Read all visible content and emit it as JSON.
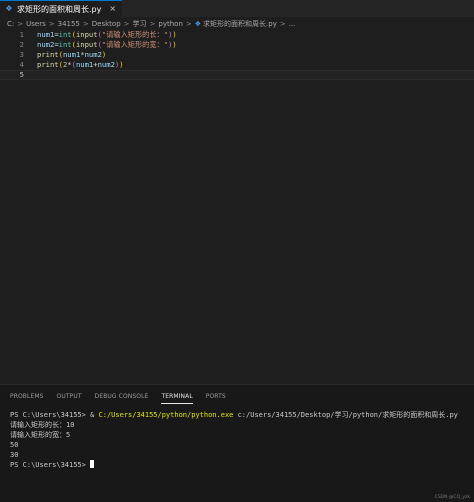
{
  "tab": {
    "title": "求矩形的面积和周长.py",
    "close": "×",
    "file_icon": "python-file-icon"
  },
  "breadcrumb": {
    "items": [
      "C:",
      "Users",
      "34155",
      "Desktop",
      "学习",
      "python"
    ],
    "separator": ">",
    "file": "求矩形的面积和周长.py",
    "trailing": "..."
  },
  "editor": {
    "line_numbers": [
      "1",
      "2",
      "3",
      "4",
      "5"
    ],
    "lines": [
      {
        "t1": "num1",
        "t2": "=",
        "t3": "int",
        "t4": "(",
        "t5": "input",
        "t6": "(",
        "t7": "\"请输入矩形的长：\"",
        "t8": ")",
        "t9": ")"
      },
      {
        "t1": "num2",
        "t2": "=",
        "t3": "int",
        "t4": "(",
        "t5": "input",
        "t6": "(",
        "t7": "\"请输入矩形的宽：\"",
        "t8": ")",
        "t9": ")"
      },
      {
        "t1": "print",
        "t2": "(",
        "t3": "num1",
        "t4": "*",
        "t5": "num2",
        "t6": ")"
      },
      {
        "t1": "print",
        "t2": "(",
        "t3": "2",
        "t4": "*",
        "t5": "(",
        "t6": "num1",
        "t7": "+",
        "t8": "num2",
        "t9": ")",
        "t10": ")"
      }
    ]
  },
  "panel": {
    "tabs": [
      "PROBLEMS",
      "OUTPUT",
      "DEBUG CONSOLE",
      "TERMINAL",
      "PORTS"
    ],
    "active_tab": "TERMINAL",
    "terminal": {
      "line1_prompt": "PS C:\\Users\\34155> & ",
      "line1_exe": "C:/Users/34155/python/python.exe",
      "line1_arg": " c:/Users/34155/Desktop/学习/python/求矩形的面积和周长.py",
      "line2": "请输入矩形的长：10",
      "line3": "请输入矩形的宽：5",
      "line4": "50",
      "line5": "30",
      "line6_prompt": "PS C:\\Users\\34155> "
    }
  },
  "watermark": "CSDN @CQ_yzk"
}
